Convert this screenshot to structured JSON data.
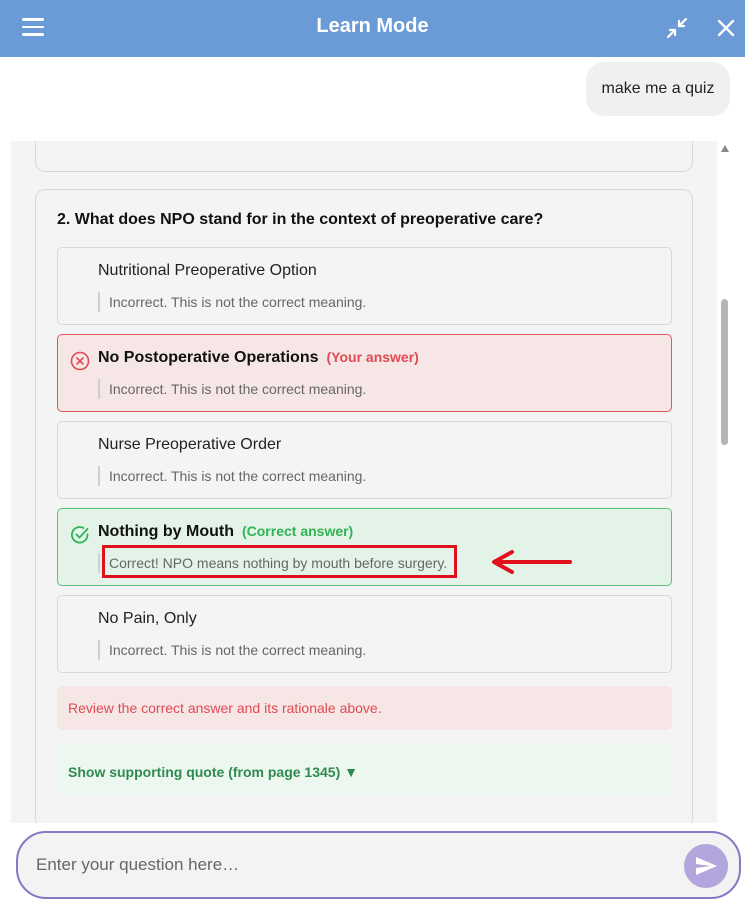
{
  "header": {
    "title": "Learn Mode"
  },
  "chat": {
    "user_message": "make me a quiz"
  },
  "quiz": {
    "question": "2. What does NPO stand for in the context of preoperative care?",
    "options": [
      {
        "label": "Nutritional Preoperative Option",
        "tag": "",
        "rationale": "Incorrect. This is not the correct meaning."
      },
      {
        "label": "No Postoperative Operations",
        "tag": "(Your answer)",
        "rationale": "Incorrect. This is not the correct meaning."
      },
      {
        "label": "Nurse Preoperative Order",
        "tag": "",
        "rationale": "Incorrect. This is not the correct meaning."
      },
      {
        "label": "Nothing by Mouth",
        "tag": "(Correct answer)",
        "rationale": "Correct! NPO means nothing by mouth before surgery."
      },
      {
        "label": "No Pain, Only",
        "tag": "",
        "rationale": "Incorrect. This is not the correct meaning."
      }
    ],
    "review_message": "Review the correct answer and its rationale above.",
    "quote_toggle": "Show supporting quote (from page 1345) ▼"
  },
  "input": {
    "placeholder": "Enter your question here…"
  },
  "icons": {
    "menu": "hamburger-menu-icon",
    "collapse": "collapse-arrows-icon",
    "close": "close-icon",
    "incorrect": "x-circle-icon",
    "correct": "check-circle-icon",
    "send": "paper-plane-icon",
    "annotation": "red-arrow-icon"
  },
  "colors": {
    "header": "#6b9bd6",
    "incorrect": "#e04a52",
    "correct": "#2fb455",
    "annotation": "#e0101d",
    "input_border": "#8a76c4",
    "send_button": "#b3a6dc"
  }
}
